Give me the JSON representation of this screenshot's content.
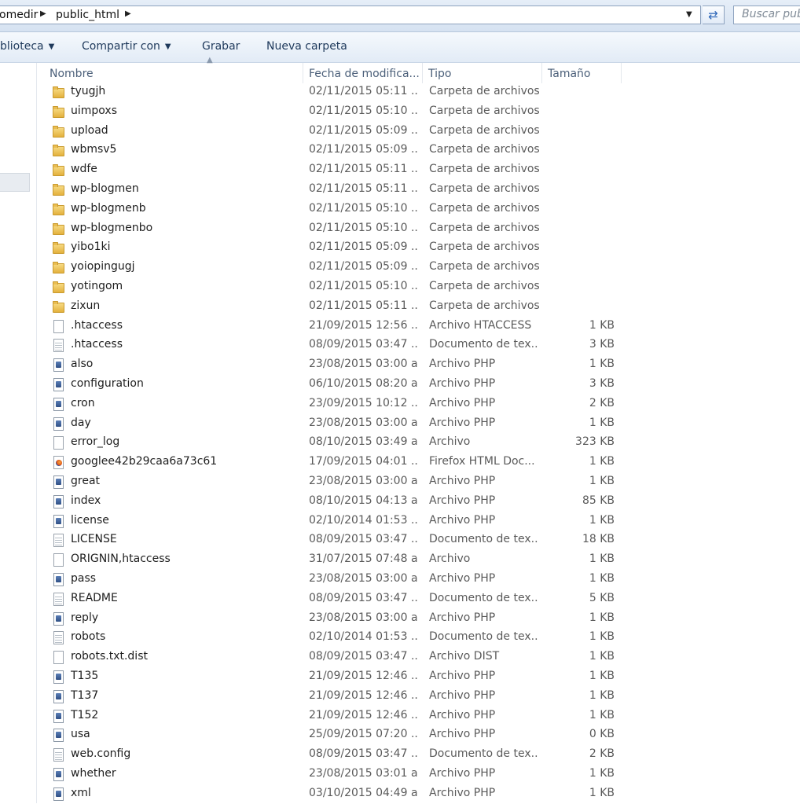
{
  "address": {
    "crumbs": [
      "omedir",
      "public_html"
    ],
    "search_placeholder": "Buscar public_html"
  },
  "toolbar": {
    "biblioteca": "blioteca",
    "compartir": "Compartir con",
    "grabar": "Grabar",
    "nueva_carpeta": "Nueva carpeta"
  },
  "columns": {
    "name": "Nombre",
    "date": "Fecha de modifica...",
    "type": "Tipo",
    "size": "Tamaño"
  },
  "files": [
    {
      "icon": "folder",
      "name": "tyugjh",
      "date": "02/11/2015 05:11 ...",
      "type": "Carpeta de archivos",
      "size": ""
    },
    {
      "icon": "folder",
      "name": "uimpoxs",
      "date": "02/11/2015 05:10 ...",
      "type": "Carpeta de archivos",
      "size": ""
    },
    {
      "icon": "folder",
      "name": "upload",
      "date": "02/11/2015 05:09 ...",
      "type": "Carpeta de archivos",
      "size": ""
    },
    {
      "icon": "folder",
      "name": "wbmsv5",
      "date": "02/11/2015 05:09 ...",
      "type": "Carpeta de archivos",
      "size": ""
    },
    {
      "icon": "folder",
      "name": "wdfe",
      "date": "02/11/2015 05:11 ...",
      "type": "Carpeta de archivos",
      "size": ""
    },
    {
      "icon": "folder",
      "name": "wp-blogmen",
      "date": "02/11/2015 05:11 ...",
      "type": "Carpeta de archivos",
      "size": ""
    },
    {
      "icon": "folder",
      "name": "wp-blogmenb",
      "date": "02/11/2015 05:10 ...",
      "type": "Carpeta de archivos",
      "size": ""
    },
    {
      "icon": "folder",
      "name": "wp-blogmenbo",
      "date": "02/11/2015 05:10 ...",
      "type": "Carpeta de archivos",
      "size": ""
    },
    {
      "icon": "folder",
      "name": "yibo1ki",
      "date": "02/11/2015 05:09 ...",
      "type": "Carpeta de archivos",
      "size": ""
    },
    {
      "icon": "folder",
      "name": "yoiopingugj",
      "date": "02/11/2015 05:09 ...",
      "type": "Carpeta de archivos",
      "size": ""
    },
    {
      "icon": "folder",
      "name": "yotingom",
      "date": "02/11/2015 05:10 ...",
      "type": "Carpeta de archivos",
      "size": ""
    },
    {
      "icon": "folder",
      "name": "zixun",
      "date": "02/11/2015 05:11 ...",
      "type": "Carpeta de archivos",
      "size": ""
    },
    {
      "icon": "file",
      "name": ".htaccess",
      "date": "21/09/2015 12:56 ...",
      "type": "Archivo HTACCESS",
      "size": "1 KB"
    },
    {
      "icon": "text",
      "name": ".htaccess",
      "date": "08/09/2015 03:47 ...",
      "type": "Documento de tex...",
      "size": "3 KB"
    },
    {
      "icon": "php",
      "name": "also",
      "date": "23/08/2015 03:00 a...",
      "type": "Archivo PHP",
      "size": "1 KB"
    },
    {
      "icon": "php",
      "name": "configuration",
      "date": "06/10/2015 08:20 a...",
      "type": "Archivo PHP",
      "size": "3 KB"
    },
    {
      "icon": "php",
      "name": "cron",
      "date": "23/09/2015 10:12 ...",
      "type": "Archivo PHP",
      "size": "2 KB"
    },
    {
      "icon": "php",
      "name": "day",
      "date": "23/08/2015 03:00 a...",
      "type": "Archivo PHP",
      "size": "1 KB"
    },
    {
      "icon": "file",
      "name": "error_log",
      "date": "08/10/2015 03:49 a...",
      "type": "Archivo",
      "size": "323 KB"
    },
    {
      "icon": "html",
      "name": "googlee42b29caa6a73c61",
      "date": "17/09/2015 04:01 ...",
      "type": "Firefox HTML Doc...",
      "size": "1 KB"
    },
    {
      "icon": "php",
      "name": "great",
      "date": "23/08/2015 03:00 a...",
      "type": "Archivo PHP",
      "size": "1 KB"
    },
    {
      "icon": "php",
      "name": "index",
      "date": "08/10/2015 04:13 a...",
      "type": "Archivo PHP",
      "size": "85 KB"
    },
    {
      "icon": "php",
      "name": "license",
      "date": "02/10/2014 01:53 ...",
      "type": "Archivo PHP",
      "size": "1 KB"
    },
    {
      "icon": "text",
      "name": "LICENSE",
      "date": "08/09/2015 03:47 ...",
      "type": "Documento de tex...",
      "size": "18 KB"
    },
    {
      "icon": "file",
      "name": "ORIGNIN,htaccess",
      "date": "31/07/2015 07:48 a...",
      "type": "Archivo",
      "size": "1 KB"
    },
    {
      "icon": "php",
      "name": "pass",
      "date": "23/08/2015 03:00 a...",
      "type": "Archivo PHP",
      "size": "1 KB"
    },
    {
      "icon": "text",
      "name": "README",
      "date": "08/09/2015 03:47 ...",
      "type": "Documento de tex...",
      "size": "5 KB"
    },
    {
      "icon": "php",
      "name": "reply",
      "date": "23/08/2015 03:00 a...",
      "type": "Archivo PHP",
      "size": "1 KB"
    },
    {
      "icon": "text",
      "name": "robots",
      "date": "02/10/2014 01:53 ...",
      "type": "Documento de tex...",
      "size": "1 KB"
    },
    {
      "icon": "file",
      "name": "robots.txt.dist",
      "date": "08/09/2015 03:47 ...",
      "type": "Archivo DIST",
      "size": "1 KB"
    },
    {
      "icon": "php",
      "name": "T135",
      "date": "21/09/2015 12:46 ...",
      "type": "Archivo PHP",
      "size": "1 KB"
    },
    {
      "icon": "php",
      "name": "T137",
      "date": "21/09/2015 12:46 ...",
      "type": "Archivo PHP",
      "size": "1 KB"
    },
    {
      "icon": "php",
      "name": "T152",
      "date": "21/09/2015 12:46 ...",
      "type": "Archivo PHP",
      "size": "1 KB"
    },
    {
      "icon": "php",
      "name": "usa",
      "date": "25/09/2015 07:20 ...",
      "type": "Archivo PHP",
      "size": "0 KB"
    },
    {
      "icon": "text",
      "name": "web.config",
      "date": "08/09/2015 03:47 ...",
      "type": "Documento de tex...",
      "size": "2 KB"
    },
    {
      "icon": "php",
      "name": "whether",
      "date": "23/08/2015 03:01 a...",
      "type": "Archivo PHP",
      "size": "1 KB"
    },
    {
      "icon": "php",
      "name": "xml",
      "date": "03/10/2015 04:49 a...",
      "type": "Archivo PHP",
      "size": "1 KB"
    }
  ]
}
